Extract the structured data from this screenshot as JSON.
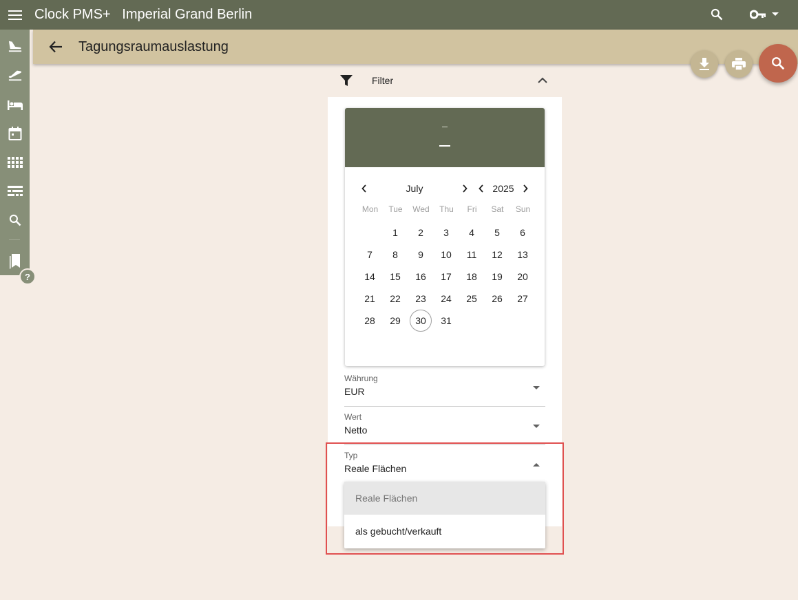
{
  "app": {
    "title": "Clock PMS+   Imperial Grand Berlin"
  },
  "icons": {
    "menu": "menu-icon",
    "search": "search-icon",
    "key": "key-icon",
    "rail": [
      "arrival-icon",
      "departure-icon",
      "bed-icon",
      "calendar-icon",
      "grid-icon",
      "rack-icon",
      "search-icon",
      "bookmark-icon"
    ]
  },
  "page": {
    "title": "Tagungsraumauslastung"
  },
  "help": {
    "label": "?"
  },
  "filter": {
    "label": "Filter"
  },
  "calendar": {
    "month": "July",
    "year": "2025",
    "weekdays": [
      "Mon",
      "Tue",
      "Wed",
      "Thu",
      "Fri",
      "Sat",
      "Sun"
    ],
    "days": [
      "1",
      "2",
      "3",
      "4",
      "5",
      "6",
      "7",
      "8",
      "9",
      "10",
      "11",
      "12",
      "13",
      "14",
      "15",
      "16",
      "17",
      "18",
      "19",
      "20",
      "21",
      "22",
      "23",
      "24",
      "25",
      "26",
      "27",
      "28",
      "29",
      "30",
      "31"
    ],
    "first_weekday_index": 1,
    "today": "30"
  },
  "fields": {
    "currency": {
      "label": "Währung",
      "value": "EUR"
    },
    "value": {
      "label": "Wert",
      "value": "Netto"
    },
    "type": {
      "label": "Typ",
      "value": "Reale Flächen"
    }
  },
  "dropdown": {
    "options": [
      "Reale Flächen",
      "als gebucht/verkauft"
    ],
    "selected": "Reale Flächen"
  },
  "colors": {
    "topbar": "#636a54",
    "rail": "#878f78",
    "header": "#d1c3a0",
    "accent": "#c0664d",
    "highlight": "#e05050"
  }
}
